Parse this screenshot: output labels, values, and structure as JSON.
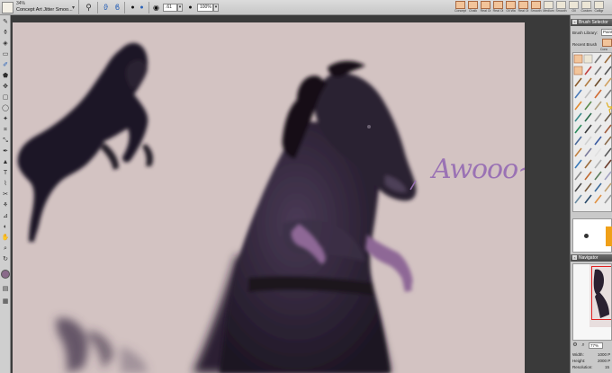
{
  "property_bar": {
    "brush_size": "34%",
    "brush_name": "Concept Art Jitter Smoo...",
    "field_value_a": ".61",
    "field_value_b": "100%"
  },
  "recent_brushes": [
    {
      "label": "Concept"
    },
    {
      "label": "Chalk"
    },
    {
      "label": "Real Oi"
    },
    {
      "label": "Real Oi"
    },
    {
      "label": "Oil Wa"
    },
    {
      "label": "Real Oi"
    },
    {
      "label": "Smooth"
    },
    {
      "label": "Medium"
    },
    {
      "label": "Smooth"
    },
    {
      "label": "Oil"
    },
    {
      "label": "Custom"
    },
    {
      "label": "Calligr"
    }
  ],
  "canvas": {
    "background_color": "#d3c3c2",
    "annotation_text": "Awooo~!",
    "annotation_color": "#9a72b4"
  },
  "brush_selector": {
    "title": "Brush Selector",
    "library_label": "Brush Library:",
    "library_value": "Paint",
    "recent_label": "Recent Brush",
    "recent_thumb_label": "Conc"
  },
  "color": {
    "main": "#8a6a8a",
    "preview_color": "#f0a018"
  },
  "navigator": {
    "title": "Navigator",
    "zoom": "77%",
    "width_label": "Width:",
    "width_value": "1000 P",
    "height_label": "Height:",
    "height_value": "2000 P",
    "resolution_label": "Resolution:",
    "resolution_value": "15"
  }
}
